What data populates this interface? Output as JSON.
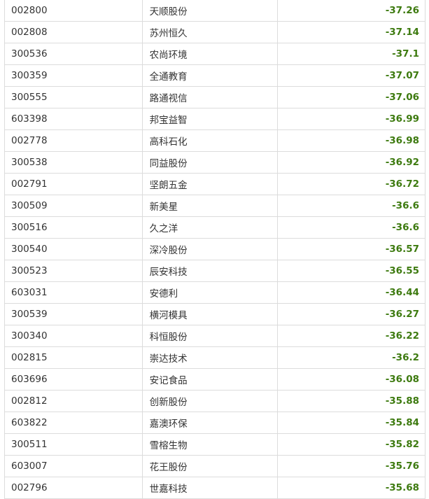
{
  "table": {
    "rows": [
      {
        "code": "002800",
        "name": "天顺股份",
        "value": "-37.26"
      },
      {
        "code": "002808",
        "name": "苏州恒久",
        "value": "-37.14"
      },
      {
        "code": "300536",
        "name": "农尚环境",
        "value": "-37.1"
      },
      {
        "code": "300359",
        "name": "全通教育",
        "value": "-37.07"
      },
      {
        "code": "300555",
        "name": "路通视信",
        "value": "-37.06"
      },
      {
        "code": "603398",
        "name": "邦宝益智",
        "value": "-36.99"
      },
      {
        "code": "002778",
        "name": "高科石化",
        "value": "-36.98"
      },
      {
        "code": "300538",
        "name": "同益股份",
        "value": "-36.92"
      },
      {
        "code": "002791",
        "name": "坚朗五金",
        "value": "-36.72"
      },
      {
        "code": "300509",
        "name": "新美星",
        "value": "-36.6"
      },
      {
        "code": "300516",
        "name": "久之洋",
        "value": "-36.6"
      },
      {
        "code": "300540",
        "name": "深冷股份",
        "value": "-36.57"
      },
      {
        "code": "300523",
        "name": "辰安科技",
        "value": "-36.55"
      },
      {
        "code": "603031",
        "name": "安德利",
        "value": "-36.44"
      },
      {
        "code": "300539",
        "name": "横河模具",
        "value": "-36.27"
      },
      {
        "code": "300340",
        "name": "科恒股份",
        "value": "-36.22"
      },
      {
        "code": "002815",
        "name": "崇达技术",
        "value": "-36.2"
      },
      {
        "code": "603696",
        "name": "安记食品",
        "value": "-36.08"
      },
      {
        "code": "002812",
        "name": "创新股份",
        "value": "-35.88"
      },
      {
        "code": "603822",
        "name": "嘉澳环保",
        "value": "-35.84"
      },
      {
        "code": "300511",
        "name": "雪榕生物",
        "value": "-35.82"
      },
      {
        "code": "603007",
        "name": "花王股份",
        "value": "-35.76"
      },
      {
        "code": "002796",
        "name": "世嘉科技",
        "value": "-35.68"
      }
    ]
  },
  "colors": {
    "value_text": "#3d7a0f",
    "cell_text": "#333333",
    "border": "#dcdcdc"
  }
}
